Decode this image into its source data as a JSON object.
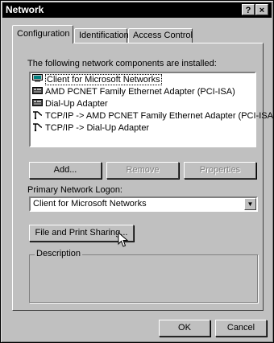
{
  "window": {
    "title": "Network",
    "help_label": "?",
    "close_label": "×"
  },
  "tabs": [
    {
      "label": "Configuration",
      "active": true
    },
    {
      "label": "Identification",
      "active": false
    },
    {
      "label": "Access Control",
      "active": false
    }
  ],
  "configuration": {
    "components_label": "The following network components are installed:",
    "components": [
      {
        "label": "Client for Microsoft Networks",
        "icon": "client-icon",
        "selected": true
      },
      {
        "label": "AMD PCNET Family Ethernet Adapter (PCI-ISA)",
        "icon": "network-adapter-icon",
        "selected": false
      },
      {
        "label": "Dial-Up Adapter",
        "icon": "network-adapter-icon",
        "selected": false
      },
      {
        "label": "TCP/IP -> AMD PCNET Family Ethernet Adapter (PCI-ISA)",
        "icon": "protocol-icon",
        "selected": false
      },
      {
        "label": "TCP/IP -> Dial-Up Adapter",
        "icon": "protocol-icon",
        "selected": false
      }
    ],
    "add_label": "Add...",
    "remove_label": "Remove",
    "properties_label": "Properties",
    "logon_label": "Primary Network Logon:",
    "logon_value": "Client for Microsoft Networks",
    "file_print_label": "File and Print Sharing...",
    "description_label": "Description"
  },
  "footer": {
    "ok_label": "OK",
    "cancel_label": "Cancel"
  }
}
